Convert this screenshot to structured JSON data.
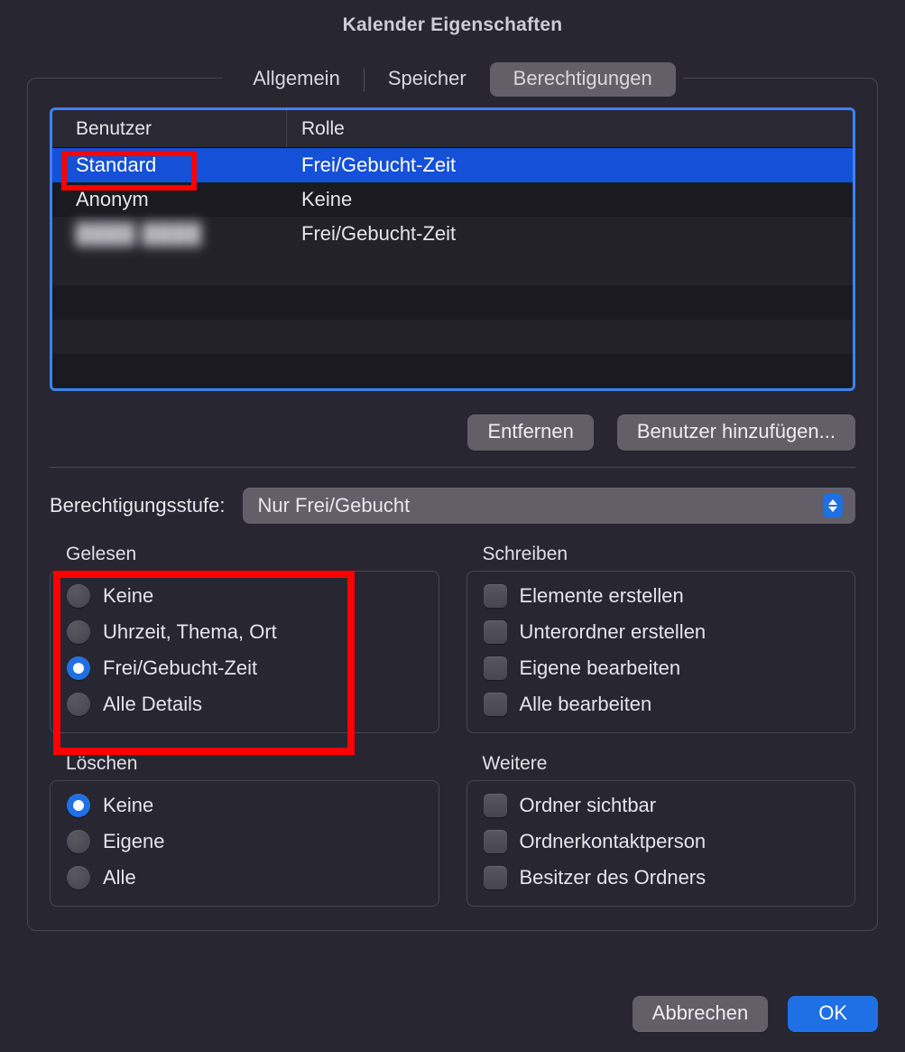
{
  "title": "Kalender Eigenschaften",
  "tabs": {
    "general": "Allgemein",
    "storage": "Speicher",
    "permissions": "Berechtigungen"
  },
  "table": {
    "headers": {
      "user": "Benutzer",
      "role": "Rolle"
    },
    "rows": [
      {
        "user": "Standard",
        "role": "Frei/Gebucht-Zeit",
        "selected": true,
        "highlight": true
      },
      {
        "user": "Anonym",
        "role": "Keine"
      },
      {
        "user": "████ ████",
        "role": "Frei/Gebucht-Zeit",
        "blurred": true
      }
    ]
  },
  "actions": {
    "remove": "Entfernen",
    "addUser": "Benutzer hinzufügen..."
  },
  "permLevel": {
    "label": "Berechtigungsstufe:",
    "value": "Nur Frei/Gebucht"
  },
  "read": {
    "title": "Gelesen",
    "items": [
      "Keine",
      "Uhrzeit, Thema, Ort",
      "Frei/Gebucht-Zeit",
      "Alle Details"
    ],
    "selectedIndex": 2
  },
  "write": {
    "title": "Schreiben",
    "items": [
      "Elemente erstellen",
      "Unterordner erstellen",
      "Eigene bearbeiten",
      "Alle bearbeiten"
    ]
  },
  "del": {
    "title": "Löschen",
    "items": [
      "Keine",
      "Eigene",
      "Alle"
    ],
    "selectedIndex": 0
  },
  "other": {
    "title": "Weitere",
    "items": [
      "Ordner sichtbar",
      "Ordnerkontaktperson",
      "Besitzer des Ordners"
    ]
  },
  "footer": {
    "cancel": "Abbrechen",
    "ok": "OK"
  }
}
